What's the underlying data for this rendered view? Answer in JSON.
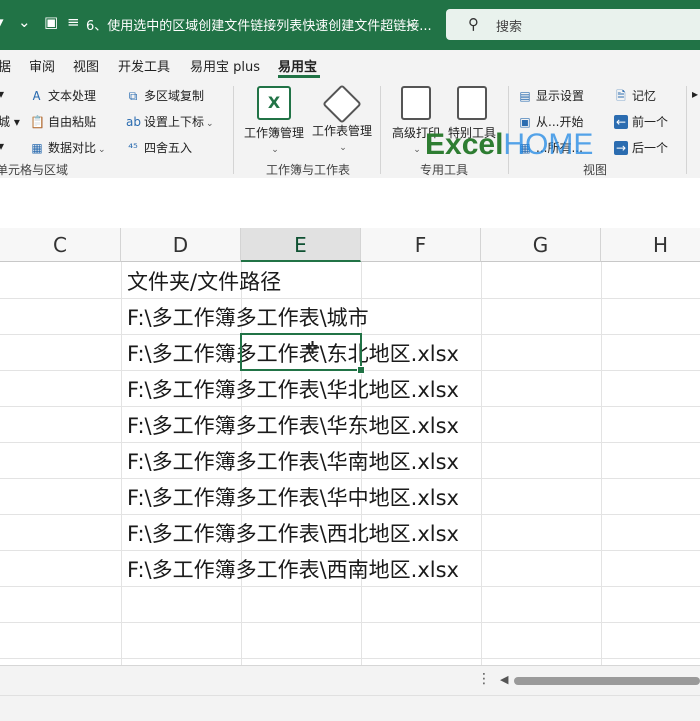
{
  "titlebar": {
    "title": "6、使用选中的区域创建文件链接列表快速创建文件超链接...",
    "search_placeholder": "搜索"
  },
  "tabs": [
    "据",
    "审阅",
    "视图",
    "开发工具",
    "易用宝 plus",
    "易用宝"
  ],
  "active_tab": "易用宝",
  "ribbon": {
    "g1": {
      "left_col": [
        "▾",
        "城 ▾",
        "▾"
      ],
      "col2": [
        "文本处理",
        "自由粘贴",
        "数据对比"
      ],
      "col3": [
        "多区域复制",
        "设置上下标",
        "四舍五入"
      ],
      "label": "单元格与区域"
    },
    "g2": {
      "btn1": "工作簿管理",
      "btn2": "工作表管理",
      "label": "工作簿与工作表"
    },
    "g3": {
      "btn1": "高级打印",
      "btn2": "特别工具",
      "label": "专用工具"
    },
    "g4": {
      "items": [
        "显示设置",
        "从...开始",
        "...所有..."
      ],
      "label": "视图"
    },
    "g5": {
      "items": [
        "记忆",
        "前一个",
        "后一个"
      ]
    },
    "watermark_a": "Excel",
    "watermark_b": "HOME"
  },
  "grid": {
    "columns": [
      "C",
      "D",
      "E",
      "F",
      "G",
      "H"
    ],
    "selected_column": "E",
    "rows": [
      "文件夹/文件路径",
      "F:\\多工作簿多工作表\\城市",
      "F:\\多工作簿多工作表\\东北地区.xlsx",
      "F:\\多工作簿多工作表\\华北地区.xlsx",
      "F:\\多工作簿多工作表\\华东地区.xlsx",
      "F:\\多工作簿多工作表\\华南地区.xlsx",
      "F:\\多工作簿多工作表\\华中地区.xlsx",
      "F:\\多工作簿多工作表\\西北地区.xlsx",
      "F:\\多工作簿多工作表\\西南地区.xlsx"
    ]
  },
  "colors": {
    "accent": "#217346",
    "watermark_green": "#2e7d32",
    "watermark_blue": "#1e88e5"
  }
}
